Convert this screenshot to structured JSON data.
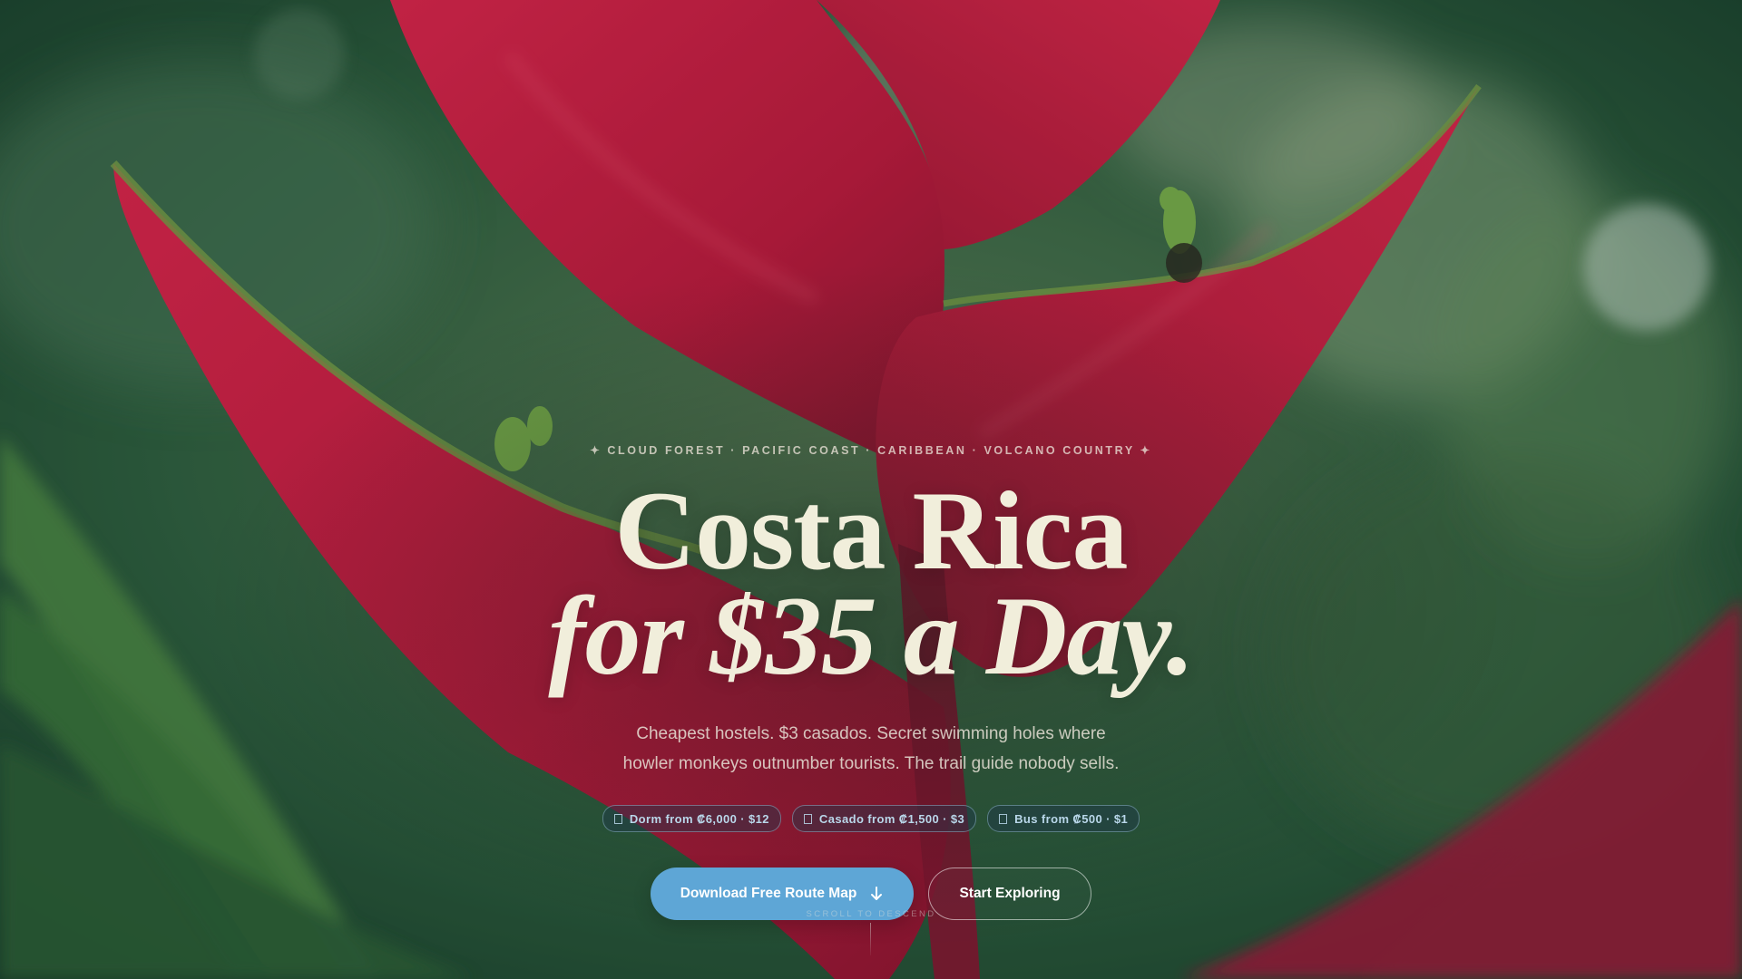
{
  "hero": {
    "eyebrow": "✦ CLOUD FOREST · PACIFIC COAST · CARIBBEAN · VOLCANO COUNTRY ✦",
    "title_line1": "Costa Rica",
    "title_line2": "for $35 a Day.",
    "subtitle_line1": "Cheapest hostels. $3 casados. Secret swimming holes where",
    "subtitle_line2": "howler monkeys outnumber tourists. The trail guide nobody sells.",
    "pills": [
      {
        "label": "Dorm from ₡6,000 · $12",
        "icon": "bed-icon"
      },
      {
        "label": "Casado from ₡1,500 · $3",
        "icon": "food-icon"
      },
      {
        "label": "Bus from ₡500 · $1",
        "icon": "bus-icon"
      }
    ],
    "primary_cta": "Download Free Route Map",
    "secondary_cta": "Start Exploring",
    "scroll_hint": "SCROLL TO DESCEND"
  },
  "colors": {
    "accent": "#5ea6d6",
    "title": "#f1eedb",
    "heliconia_red": "#d81b45",
    "foliage_green": "#2f6b45"
  },
  "background": {
    "subject": "heliconia-flower-photo"
  }
}
